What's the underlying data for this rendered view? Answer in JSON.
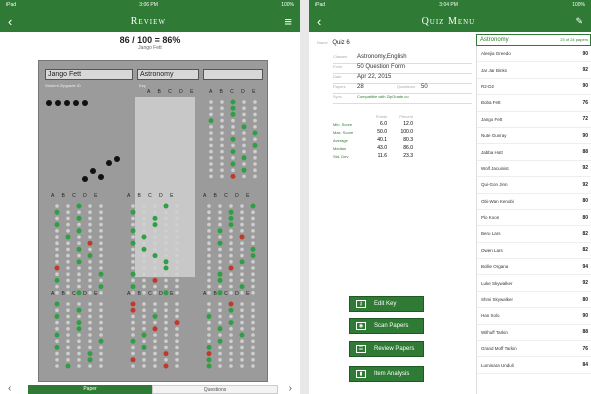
{
  "left": {
    "status": {
      "left": "iPad",
      "center": "3:06 PM",
      "right": "100%"
    },
    "nav": {
      "back": "‹",
      "title": "Review",
      "menu": "≡"
    },
    "score": "86 / 100 = 86%",
    "student": "Jango Fett",
    "sheet": {
      "name": "Jango Fett",
      "subject": "Astronomy",
      "student_id_label": "Student Zipgrade ID",
      "key_label": "Key",
      "col_letters": "A B C D E"
    },
    "tabs": [
      "Paper",
      "Questions"
    ]
  },
  "right": {
    "status": {
      "left": "iPad",
      "center": "3:04 PM",
      "right": "100%"
    },
    "nav": {
      "back": "‹",
      "title": "Quiz Menu",
      "edit": "✎"
    },
    "quiz": {
      "name_label": "Name",
      "name": "Quiz 6",
      "fields": [
        {
          "label": "Classes",
          "value": "Astronomy,English"
        },
        {
          "label": "Form",
          "value": "50 Question Form"
        },
        {
          "label": "Date",
          "value": "Apr 22, 2015"
        },
        {
          "label": "Papers",
          "value": "28",
          "extra_label": "Questions",
          "extra": "50"
        },
        {
          "label": "Sync",
          "value": "Compatible with ZipGrade.co",
          "green": true
        }
      ],
      "stats_headers": [
        "",
        "Points",
        "Percent"
      ],
      "stats": [
        {
          "label": "Min. Score",
          "points": "6.0",
          "percent": "12.0"
        },
        {
          "label": "Max. Score",
          "points": "50.0",
          "percent": "100.0"
        },
        {
          "label": "Average",
          "points": "40.1",
          "percent": "80.3"
        },
        {
          "label": "Median",
          "points": "43.0",
          "percent": "86.0"
        },
        {
          "label": "Std. Dev",
          "points": "11.6",
          "percent": "23.3"
        }
      ]
    },
    "actions": [
      {
        "label": "Edit Key",
        "icon": "key-icon"
      },
      {
        "label": "Scan Papers",
        "icon": "camera-icon"
      },
      {
        "label": "Review Papers",
        "icon": "papers-icon"
      },
      {
        "label": "Item Analysis",
        "icon": "chart-icon"
      }
    ],
    "search": {
      "value": "Astronomy",
      "count": "23 of 24 papers"
    },
    "papers": [
      {
        "name": "Aleejia Greedo",
        "score": "90"
      },
      {
        "name": "Jar Jar Binks",
        "score": "92"
      },
      {
        "name": "R2-D2",
        "score": "90"
      },
      {
        "name": "Boba Fett",
        "score": "76"
      },
      {
        "name": "Jango Fett",
        "score": "72"
      },
      {
        "name": "Nute Gunray",
        "score": "90"
      },
      {
        "name": "Jabba Hutt",
        "score": "88"
      },
      {
        "name": "Wolf Jacuinist",
        "score": "92"
      },
      {
        "name": "Qui-Gon Jinn",
        "score": "92"
      },
      {
        "name": "Obi-Wan Kenobi",
        "score": "80"
      },
      {
        "name": "Plo Koon",
        "score": "80"
      },
      {
        "name": "Beru Lars",
        "score": "82"
      },
      {
        "name": "Owen Lars",
        "score": "82"
      },
      {
        "name": "Bollie Organa",
        "score": "94"
      },
      {
        "name": "Luke Skywalker",
        "score": "92"
      },
      {
        "name": "Shmi Skywalker",
        "score": "80"
      },
      {
        "name": "Han Solo",
        "score": "90"
      },
      {
        "name": "Wilhuff Tarkin",
        "score": "88"
      },
      {
        "name": "Grand Moff Tarkin",
        "score": "76"
      },
      {
        "name": "Luminara Unduli",
        "score": "84"
      }
    ]
  }
}
